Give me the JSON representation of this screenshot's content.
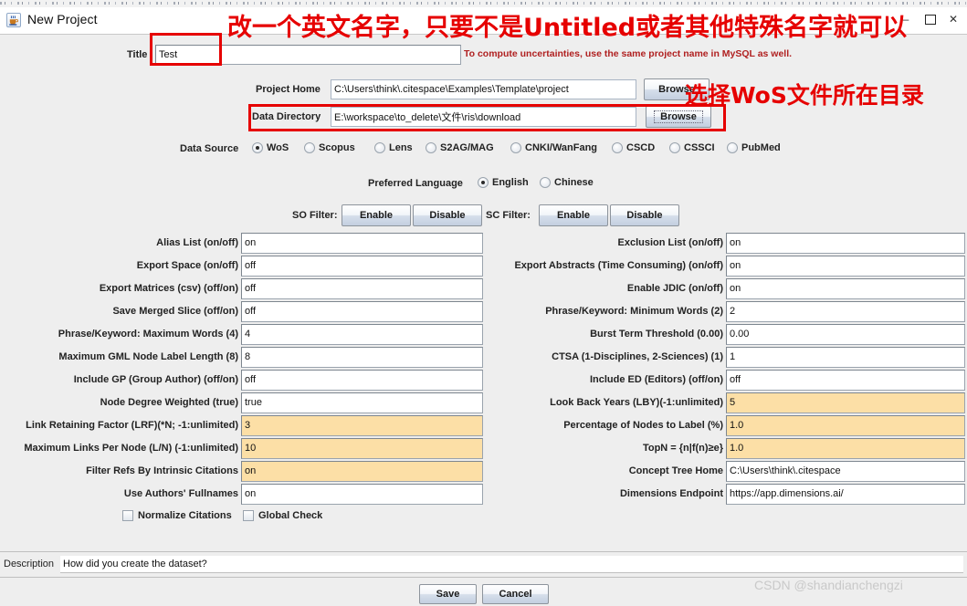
{
  "window": {
    "title": "New Project",
    "icon": "java-coffee-cup-icon",
    "minimize_label": "–",
    "maximize_label": "□",
    "close_label": "✕"
  },
  "form": {
    "title_label": "Title",
    "title_value": "Test",
    "title_hint": "To compute uncertainties, use the same project name in MySQL as well.",
    "project_home_label": "Project Home",
    "project_home_value": "C:\\Users\\think\\.citespace\\Examples\\Template\\project",
    "project_home_browse": "Browse",
    "data_directory_label": "Data Directory",
    "data_directory_value": "E:\\workspace\\to_delete\\文件\\ris\\download",
    "data_directory_browse": "Browse"
  },
  "data_source": {
    "label": "Data Source",
    "selected": "WoS",
    "options": [
      {
        "label": "WoS",
        "selected": true
      },
      {
        "label": "Scopus",
        "selected": false
      },
      {
        "label": "Lens",
        "selected": false
      },
      {
        "label": "S2AG/MAG",
        "selected": false
      },
      {
        "label": "CNKI/WanFang",
        "selected": false
      },
      {
        "label": "CSCD",
        "selected": false
      },
      {
        "label": "CSSCI",
        "selected": false
      },
      {
        "label": "PubMed",
        "selected": false
      }
    ]
  },
  "preferred_language": {
    "label": "Preferred Language",
    "selected": "English",
    "options": [
      {
        "label": "English",
        "selected": true
      },
      {
        "label": "Chinese",
        "selected": false
      }
    ]
  },
  "filters": {
    "so_label": "SO Filter:",
    "so_enable": "Enable",
    "so_disable": "Disable",
    "sc_label": "SC Filter:",
    "sc_enable": "Enable",
    "sc_disable": "Disable"
  },
  "settings_left": [
    {
      "label": "Alias List (on/off)",
      "value": "on",
      "highlight": false
    },
    {
      "label": "Export Space (on/off)",
      "value": "off",
      "highlight": false
    },
    {
      "label": "Export Matrices (csv) (off/on)",
      "value": "off",
      "highlight": false
    },
    {
      "label": "Save Merged Slice (off/on)",
      "value": "off",
      "highlight": false
    },
    {
      "label": "Phrase/Keyword: Maximum Words (4)",
      "value": "4",
      "highlight": false
    },
    {
      "label": "Maximum GML Node Label Length (8)",
      "value": "8",
      "highlight": false
    },
    {
      "label": "Include GP (Group Author) (off/on)",
      "value": "off",
      "highlight": false
    },
    {
      "label": "Node Degree Weighted (true)",
      "value": "true",
      "highlight": false
    },
    {
      "label": "Link Retaining Factor (LRF)(*N; -1:unlimited)",
      "value": "3",
      "highlight": true
    },
    {
      "label": "Maximum Links Per Node (L/N) (-1:unlimited)",
      "value": "10",
      "highlight": true
    },
    {
      "label": "Filter Refs By Intrinsic Citations",
      "value": "on",
      "highlight": true
    },
    {
      "label": "Use Authors' Fullnames",
      "value": "on",
      "highlight": false
    }
  ],
  "settings_right": [
    {
      "label": "Exclusion List (on/off)",
      "value": "on",
      "highlight": false
    },
    {
      "label": "Export Abstracts (Time Consuming) (on/off)",
      "value": "on",
      "highlight": false
    },
    {
      "label": "Enable JDIC (on/off)",
      "value": "on",
      "highlight": false
    },
    {
      "label": "Phrase/Keyword: Minimum Words (2)",
      "value": "2",
      "highlight": false
    },
    {
      "label": "Burst Term Threshold (0.00)",
      "value": "0.00",
      "highlight": false
    },
    {
      "label": "CTSA (1-Disciplines, 2-Sciences) (1)",
      "value": "1",
      "highlight": false
    },
    {
      "label": "Include ED (Editors) (off/on)",
      "value": "off",
      "highlight": false
    },
    {
      "label": "Look Back Years (LBY)(-1:unlimited)",
      "value": "5",
      "highlight": true
    },
    {
      "label": "Percentage of Nodes to Label (%)",
      "value": "1.0",
      "highlight": true
    },
    {
      "label": "TopN = {n|f(n)≥e}",
      "value": "1.0",
      "highlight": true
    },
    {
      "label": "Concept Tree Home",
      "value": "C:\\Users\\think\\.citespace",
      "highlight": false
    },
    {
      "label": "Dimensions Endpoint",
      "value": "https://app.dimensions.ai/",
      "highlight": false
    }
  ],
  "checkboxes": [
    {
      "label": "Normalize Citations",
      "checked": false
    },
    {
      "label": "Global Check",
      "checked": false
    }
  ],
  "description": {
    "label": "Description",
    "value": "How did you create the dataset?"
  },
  "actions": {
    "save": "Save",
    "cancel": "Cancel"
  },
  "annotations": {
    "top": "改一个英文名字，只要不是Untitled或者其他特殊名字就可以",
    "browse": "选择WoS文件所在目录",
    "color": "#e60000"
  },
  "watermark": "CSDN @shandianchengzi"
}
